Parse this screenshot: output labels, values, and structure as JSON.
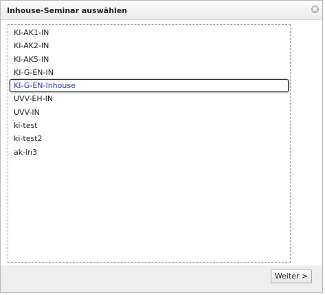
{
  "dialog": {
    "title": "Inhouse-Seminar auswählen",
    "close_icon": "close-icon"
  },
  "list": {
    "items": [
      {
        "label": "KI-AK1-IN",
        "selected": false
      },
      {
        "label": "KI-AK2-IN",
        "selected": false
      },
      {
        "label": "KI-AK5-IN",
        "selected": false
      },
      {
        "label": "KI-G-EN-IN",
        "selected": false
      },
      {
        "label": "KI-G-EN-Inhouse",
        "selected": true
      },
      {
        "label": "UVV-EH-IN",
        "selected": false
      },
      {
        "label": "UVV-IN",
        "selected": false
      },
      {
        "label": "ki-test",
        "selected": false
      },
      {
        "label": "ki-test2",
        "selected": false
      },
      {
        "label": "ak-in3",
        "selected": false
      }
    ]
  },
  "footer": {
    "next_label": "Weiter >"
  },
  "colors": {
    "selected_text": "#2433c4",
    "title_bar": "#f3f3f3",
    "footer": "#eeeeee"
  }
}
